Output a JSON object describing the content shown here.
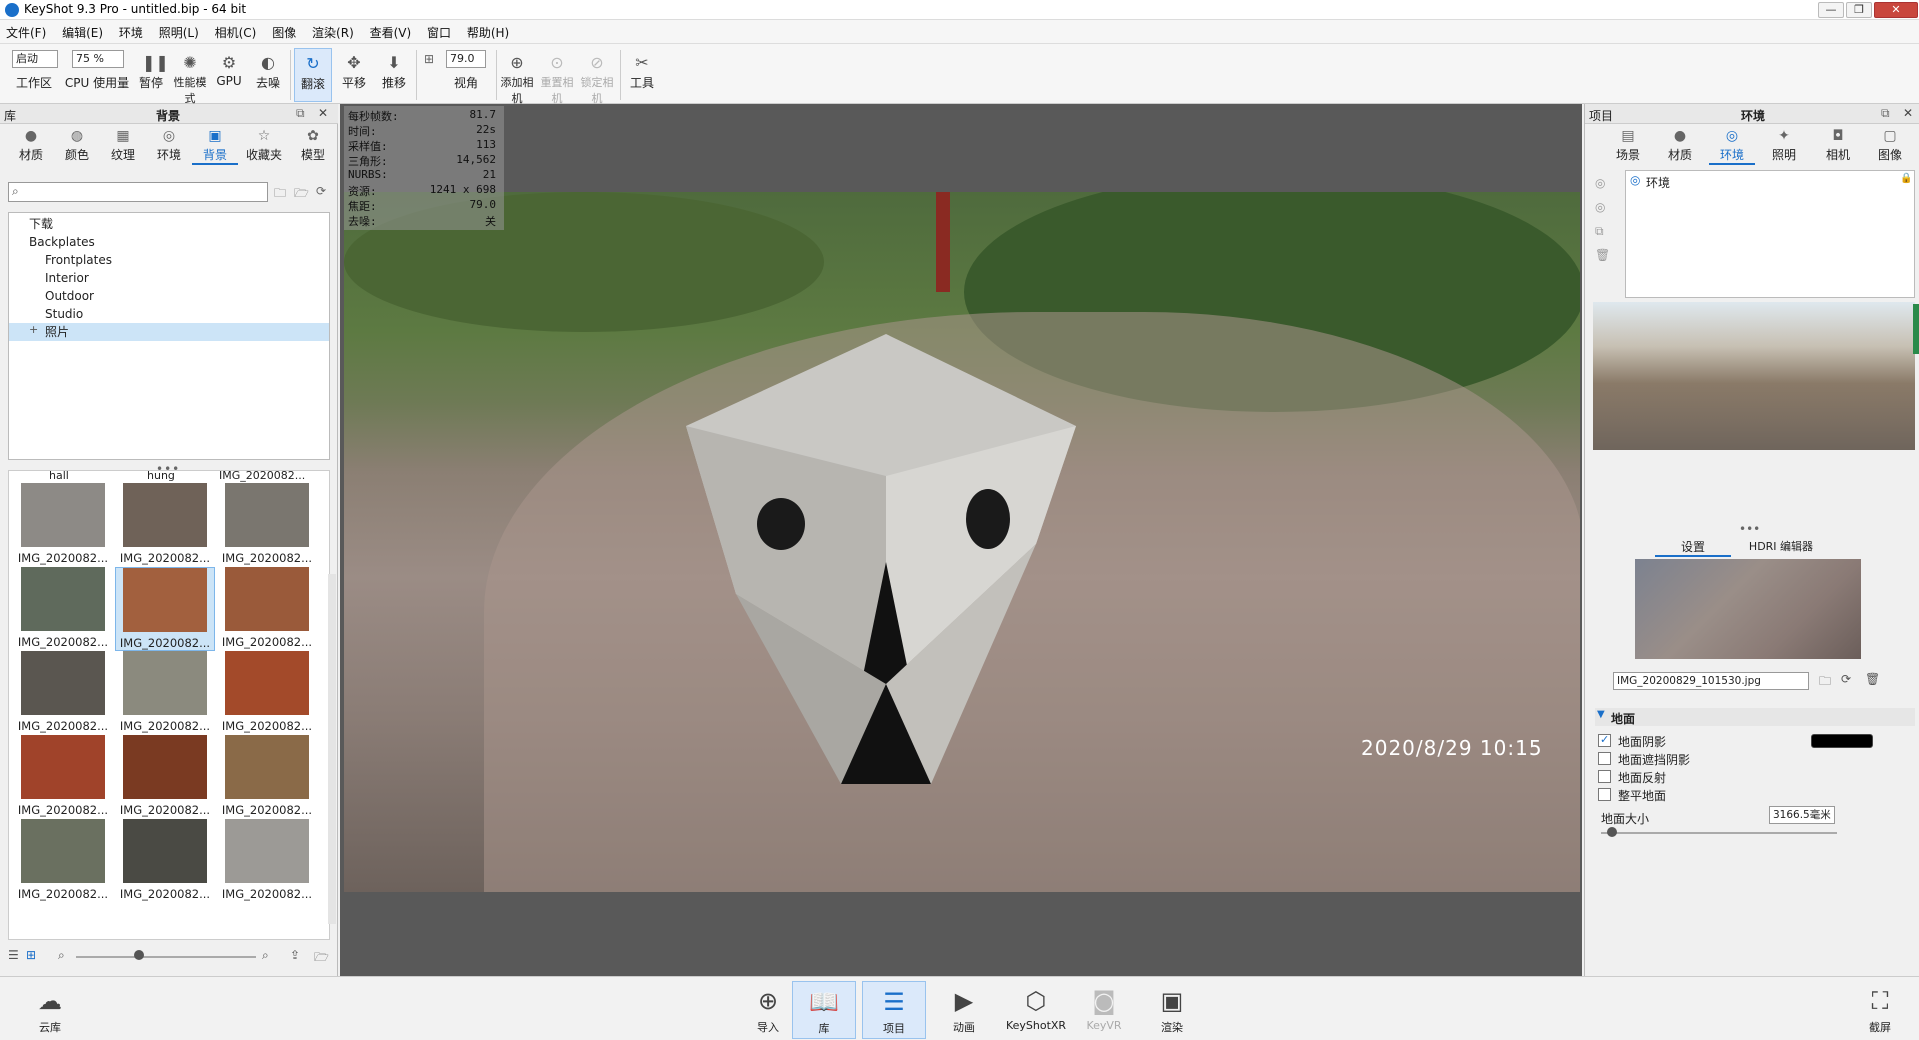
{
  "window": {
    "title": "KeyShot 9.3 Pro - untitled.bip - 64 bit",
    "min_label": "—",
    "max_label": "❐",
    "close_label": "✕"
  },
  "menu": [
    "文件(F)",
    "编辑(E)",
    "环境",
    "照明(L)",
    "相机(C)",
    "图像",
    "渲染(R)",
    "查看(V)",
    "窗口",
    "帮助(H)"
  ],
  "toolbar": {
    "startup_select": "启动",
    "zoom_select": "75 %",
    "fov_value": "79.0",
    "workspace": "工作区",
    "cpu_usage": "CPU 使用量",
    "pause": "暂停",
    "performance_mode": "性能模式",
    "gpu": "GPU",
    "denoise": "去噪",
    "tumble": "翻滚",
    "pan": "平移",
    "dolly": "推移",
    "fov": "视角",
    "add_camera": "添加相机",
    "reset_camera": "重置相机",
    "lock_camera": "锁定相机",
    "tools": "工具"
  },
  "left_panel": {
    "header_left": "库",
    "header_title": "背景",
    "tabs": [
      "材质",
      "颜色",
      "纹理",
      "环境",
      "背景",
      "收藏夹",
      "模型"
    ],
    "search_placeholder": "",
    "tree": {
      "downloads": "下载",
      "backplates": "Backplates",
      "frontplates": "Frontplates",
      "interior": "Interior",
      "outdoor": "Outdoor",
      "studio": "Studio",
      "photos": "照片"
    },
    "thumb_top_labels": [
      "hall",
      "hung",
      "IMG_2020082..."
    ],
    "thumbs": [
      "IMG_2020082...",
      "IMG_2020082...",
      "IMG_2020082...",
      "IMG_2020082...",
      "IMG_2020082...",
      "IMG_2020082...",
      "IMG_2020082...",
      "IMG_2020082...",
      "IMG_2020082...",
      "IMG_2020082...",
      "IMG_2020082...",
      "IMG_2020082...",
      "IMG_2020082...",
      "IMG_2020082...",
      "IMG_2020082..."
    ]
  },
  "viewport": {
    "stats": [
      {
        "label": "每秒帧数:",
        "value": "81.7"
      },
      {
        "label": "时间:",
        "value": "22s"
      },
      {
        "label": "采样值:",
        "value": "113"
      },
      {
        "label": "三角形:",
        "value": "14,562"
      },
      {
        "label": "NURBS:",
        "value": "21"
      },
      {
        "label": "资源:",
        "value": "1241 x 698"
      },
      {
        "label": "焦距:",
        "value": "79.0"
      },
      {
        "label": "去噪:",
        "value": "关"
      }
    ],
    "timestamp": "2020/8/29  10:15"
  },
  "right_panel": {
    "header_left": "项目",
    "header_title": "环境",
    "tabs": [
      "场景",
      "材质",
      "环境",
      "照明",
      "相机",
      "图像"
    ],
    "env_item": "环境",
    "subtabs": [
      "设置",
      "HDRI 编辑器"
    ],
    "backplate_file": "IMG_20200829_101530.jpg",
    "ground_section": "地面",
    "options": [
      {
        "label": "地面阴影",
        "checked": true
      },
      {
        "label": "地面遮挡阴影",
        "checked": false
      },
      {
        "label": "地面反射",
        "checked": false
      },
      {
        "label": "整平地面",
        "checked": false
      }
    ],
    "ground_size_label": "地面大小",
    "ground_size_value": "3166.5毫米",
    "shadow_color": "#000000"
  },
  "bottom_bar": {
    "cloud": "云库",
    "import": "导入",
    "library": "库",
    "project": "项目",
    "animation": "动画",
    "keyshotxr": "KeyShotXR",
    "keyvr": "KeyVR",
    "render": "渲染",
    "screenshot": "截屏"
  }
}
